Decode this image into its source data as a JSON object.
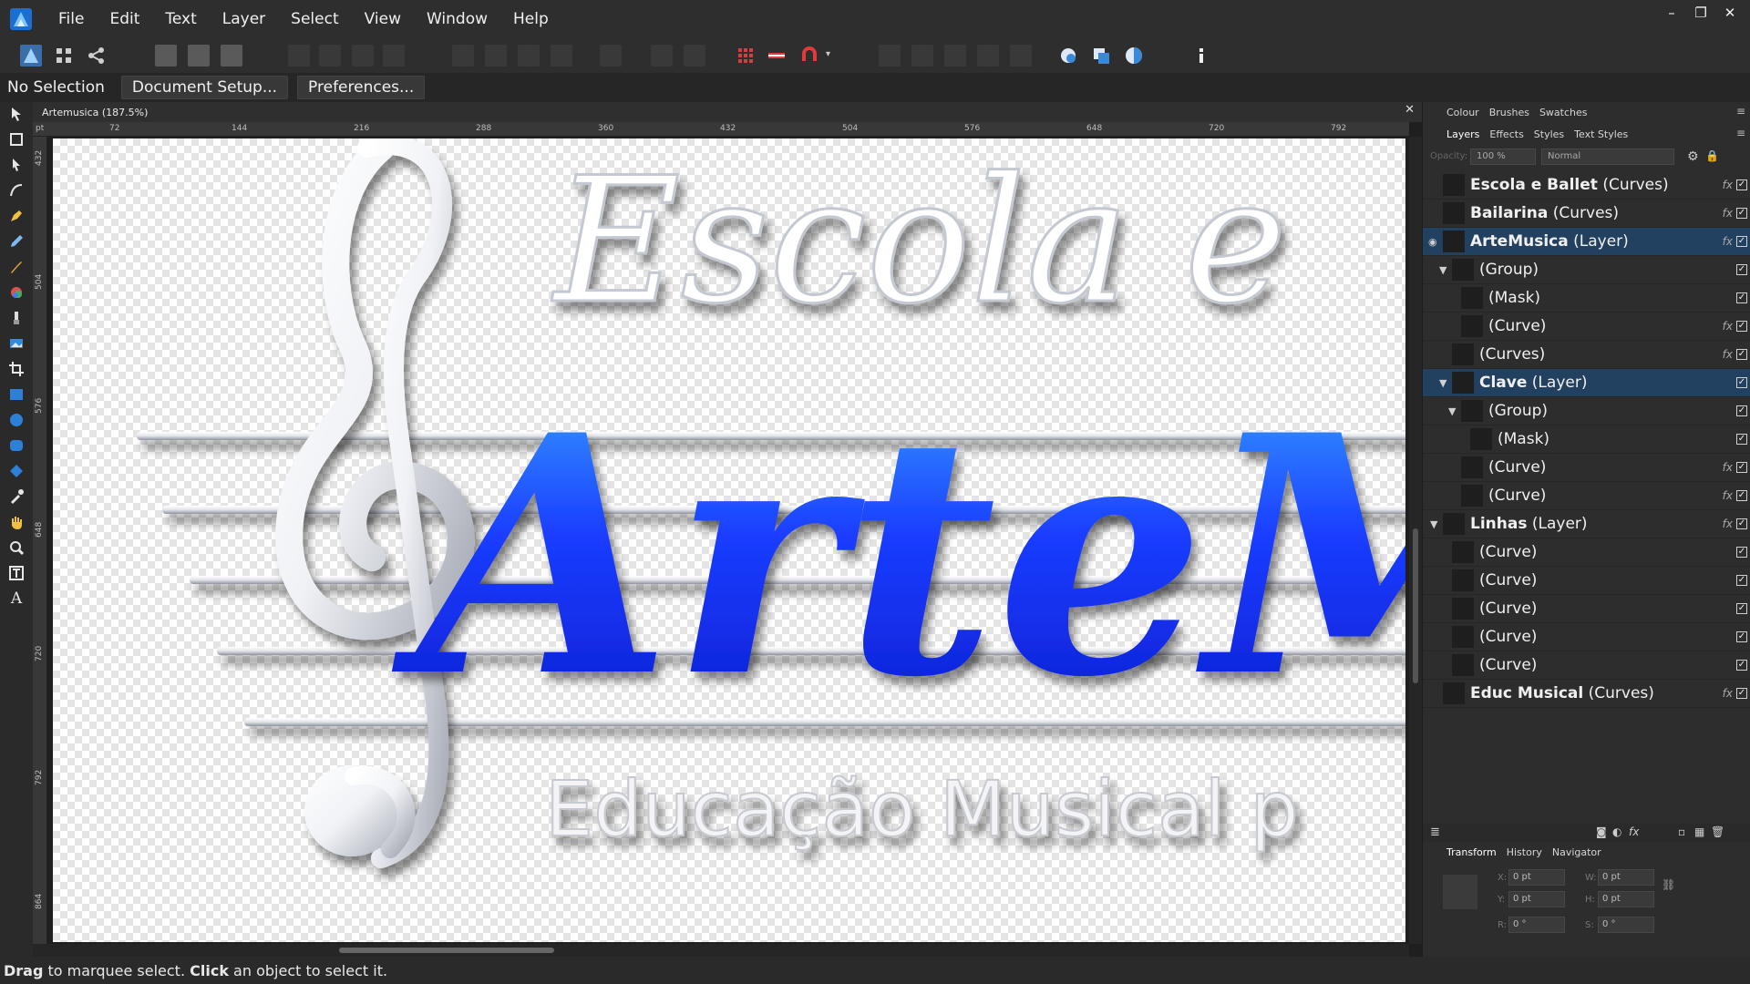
{
  "menu": [
    "File",
    "Edit",
    "Text",
    "Layer",
    "Select",
    "View",
    "Window",
    "Help"
  ],
  "context": {
    "selection_label": "No Selection",
    "document_setup": "Document Setup...",
    "preferences": "Preferences..."
  },
  "document": {
    "title": "Artemusica (187.5%)",
    "ruler_unit": "pt",
    "h_ticks": [
      "72",
      "144",
      "216",
      "288",
      "360",
      "432",
      "504",
      "576",
      "648",
      "720",
      "792"
    ],
    "v_ticks": [
      "432",
      "504",
      "576",
      "648",
      "720",
      "792",
      "864"
    ],
    "artwork": {
      "top_text": "Escola e",
      "main_text": "ArteM",
      "bottom_text": "Educação Musical p",
      "accent_color": "#1a3cff"
    }
  },
  "panels": {
    "top_tabs": [
      "Colour",
      "Brushes",
      "Swatches"
    ],
    "layer_tabs": [
      "Layers",
      "Effects",
      "Styles",
      "Text Styles"
    ],
    "opacity_label": "Opacity:",
    "opacity_value": "100 %",
    "blend_mode": "Normal",
    "layers": [
      {
        "name": "Escola e Ballet",
        "type": "(Curves)",
        "bold": true,
        "fx": true,
        "expander": ""
      },
      {
        "name": "Bailarina",
        "type": "(Curves)",
        "bold": true,
        "fx": true,
        "expander": ""
      },
      {
        "name": "ArteMusica",
        "type": "(Layer)",
        "bold": true,
        "fx": true,
        "expander": "",
        "selected": true
      },
      {
        "name": "",
        "type": "(Group)",
        "bold": false,
        "fx": false,
        "expander": "▼"
      },
      {
        "name": "",
        "type": "(Mask)",
        "bold": false,
        "fx": false,
        "expander": ""
      },
      {
        "name": "",
        "type": "(Curve)",
        "bold": false,
        "fx": true,
        "expander": ""
      },
      {
        "name": "",
        "type": "(Curves)",
        "bold": false,
        "fx": true,
        "expander": ""
      },
      {
        "name": "Clave",
        "type": "(Layer)",
        "bold": true,
        "fx": false,
        "expander": "▼",
        "selected": true
      },
      {
        "name": "",
        "type": "(Group)",
        "bold": false,
        "fx": false,
        "expander": "▼"
      },
      {
        "name": "",
        "type": "(Mask)",
        "bold": false,
        "fx": false,
        "expander": ""
      },
      {
        "name": "",
        "type": "(Curve)",
        "bold": false,
        "fx": true,
        "expander": ""
      },
      {
        "name": "",
        "type": "(Curve)",
        "bold": false,
        "fx": true,
        "expander": ""
      },
      {
        "name": "Linhas",
        "type": "(Layer)",
        "bold": true,
        "fx": true,
        "expander": "▼"
      },
      {
        "name": "",
        "type": "(Curve)",
        "bold": false,
        "fx": false,
        "expander": ""
      },
      {
        "name": "",
        "type": "(Curve)",
        "bold": false,
        "fx": false,
        "expander": ""
      },
      {
        "name": "",
        "type": "(Curve)",
        "bold": false,
        "fx": false,
        "expander": ""
      },
      {
        "name": "",
        "type": "(Curve)",
        "bold": false,
        "fx": false,
        "expander": ""
      },
      {
        "name": "",
        "type": "(Curve)",
        "bold": false,
        "fx": false,
        "expander": ""
      },
      {
        "name": "Educ Musical",
        "type": "(Curves)",
        "bold": true,
        "fx": true,
        "expander": ""
      }
    ],
    "bottom_tabs": [
      "Transform",
      "History",
      "Navigator"
    ],
    "transform": {
      "x_label": "X:",
      "x": "0 pt",
      "y_label": "Y:",
      "y": "0 pt",
      "w_label": "W:",
      "w": "0 pt",
      "h_label": "H:",
      "h": "0 pt",
      "r_label": "R:",
      "r": "0 °",
      "s_label": "S:",
      "s": "0 °"
    }
  },
  "status": {
    "drag_word": "Drag",
    "drag_text": " to marquee select. ",
    "click_word": "Click",
    "click_text": " an object to select it."
  }
}
